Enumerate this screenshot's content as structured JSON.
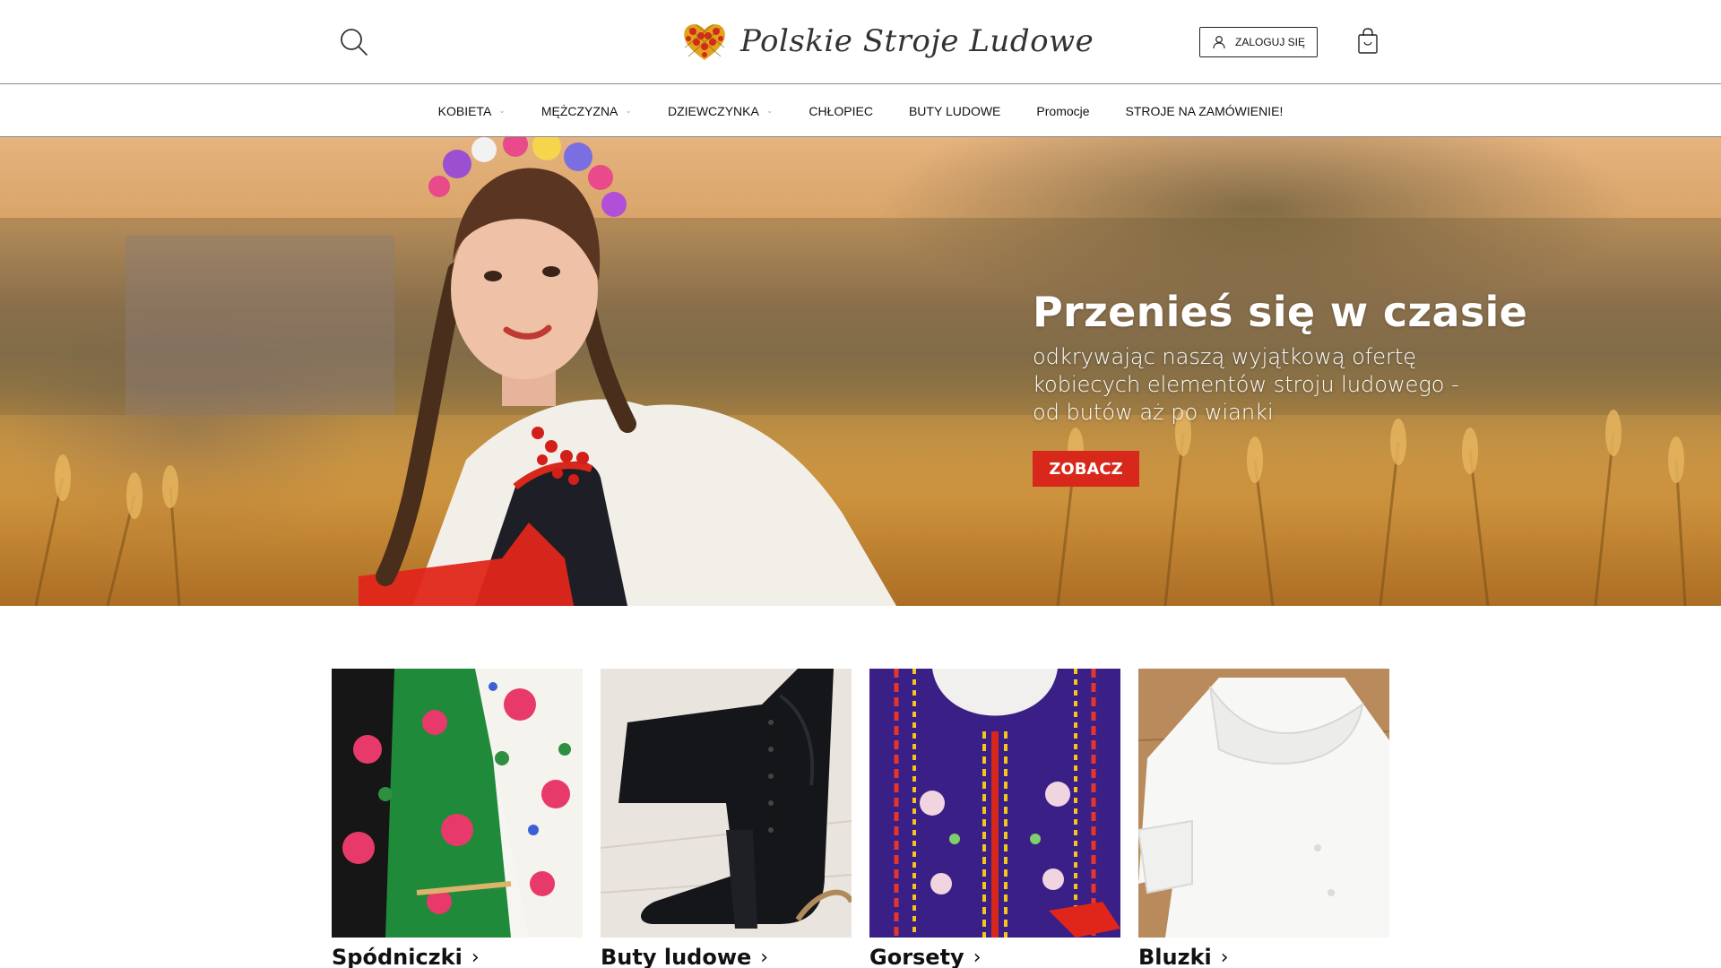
{
  "header": {
    "logo_text": "Polskie Stroje Ludowe",
    "login_label": "ZALOGUJ SIĘ",
    "icons": {
      "search": "search-icon",
      "user": "user-icon",
      "cart": "shopping-bag-icon",
      "logo": "heart-lattice-logo-icon"
    }
  },
  "nav": {
    "items": [
      {
        "label": "KOBIETA",
        "has_dropdown": true
      },
      {
        "label": "MĘŻCZYZNA",
        "has_dropdown": true
      },
      {
        "label": "DZIEWCZYNKA",
        "has_dropdown": true
      },
      {
        "label": "CHŁOPIEC",
        "has_dropdown": false
      },
      {
        "label": "BUTY LUDOWE",
        "has_dropdown": false
      },
      {
        "label": "Promocje",
        "has_dropdown": false
      },
      {
        "label": "STROJE NA ZAMÓWIENIE!",
        "has_dropdown": false
      }
    ],
    "chevron": "⌄"
  },
  "hero": {
    "title": "Przenieś się w czasie",
    "subtitle": "odkrywając naszą wyjątkową ofertę kobiecych elementów stroju ludowego - od butów aż po wianki",
    "cta": "ZOBACZ"
  },
  "categories": [
    {
      "label": "Spódniczki",
      "arrow": "›"
    },
    {
      "label": "Buty ludowe",
      "arrow": "›"
    },
    {
      "label": "Gorsety",
      "arrow": "›"
    },
    {
      "label": "Bluzki",
      "arrow": "›"
    }
  ],
  "colors": {
    "accent": "#d8271b",
    "border": "#8a8a8a",
    "text": "#111111"
  }
}
